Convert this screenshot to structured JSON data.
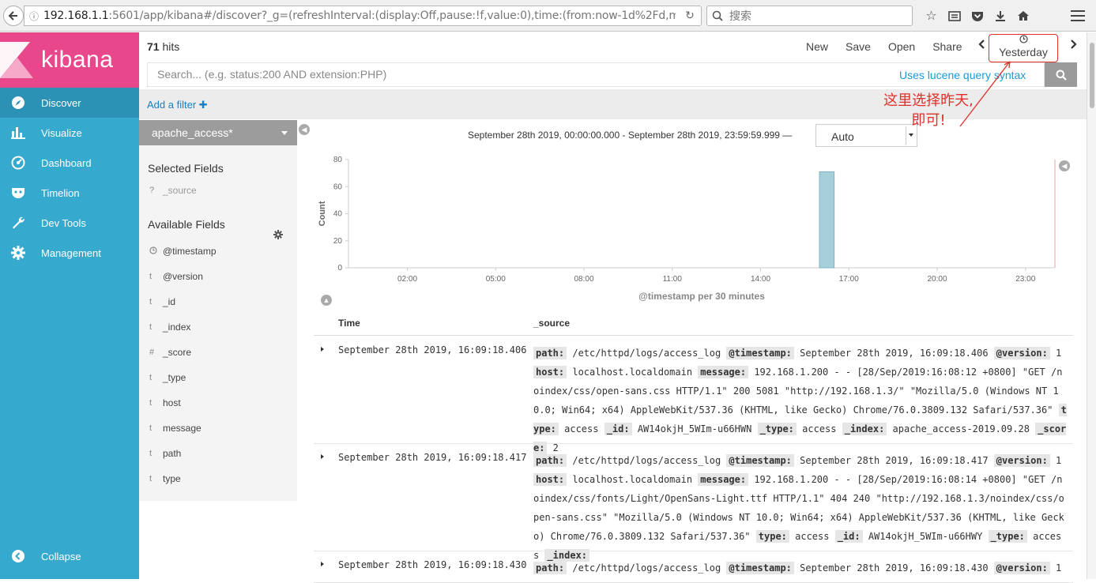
{
  "browser": {
    "url_host": "192.168.1.1",
    "url_rest": ":5601/app/kibana#/discover?_g=(refreshInterval:(display:Off,pause:!f,value:0),time:(from:now-1d%2Fd,m",
    "search_placeholder": "搜索"
  },
  "sidebar": {
    "logo_text": "kibana",
    "items": [
      {
        "label": "Discover",
        "icon": "compass-icon"
      },
      {
        "label": "Visualize",
        "icon": "bar-chart-icon"
      },
      {
        "label": "Dashboard",
        "icon": "dashboard-icon"
      },
      {
        "label": "Timelion",
        "icon": "timelion-mask-icon"
      },
      {
        "label": "Dev Tools",
        "icon": "wrench-icon"
      },
      {
        "label": "Management",
        "icon": "gear-icon"
      }
    ],
    "collapse_label": "Collapse"
  },
  "topbar": {
    "hits_count": "71",
    "hits_label": " hits",
    "actions": [
      "New",
      "Save",
      "Open",
      "Share"
    ],
    "time_picker": "Yesterday"
  },
  "query": {
    "placeholder": "Search... (e.g. status:200 AND extension:PHP)",
    "lucene_link": "Uses lucene query syntax"
  },
  "filter": {
    "add_filter": "Add a filter"
  },
  "fields": {
    "index_pattern": "apache_access*",
    "selected_title": "Selected Fields",
    "selected": [
      {
        "type": "?",
        "name": "_source"
      }
    ],
    "available_title": "Available Fields",
    "available": [
      {
        "type": "clock",
        "name": "@timestamp"
      },
      {
        "type": "t",
        "name": "@version"
      },
      {
        "type": "t",
        "name": "_id"
      },
      {
        "type": "t",
        "name": "_index"
      },
      {
        "type": "#",
        "name": "_score"
      },
      {
        "type": "t",
        "name": "_type"
      },
      {
        "type": "t",
        "name": "host"
      },
      {
        "type": "t",
        "name": "message"
      },
      {
        "type": "t",
        "name": "path"
      },
      {
        "type": "t",
        "name": "type"
      }
    ]
  },
  "histogram": {
    "range": "September 28th 2019, 00:00:00.000 - September 28th 2019, 23:59:59.999 —",
    "interval": "Auto"
  },
  "annotation": {
    "line1": "这里选择昨天,",
    "line2": "即可!"
  },
  "chart_data": {
    "type": "bar",
    "title": "",
    "xlabel": "@timestamp per 30 minutes",
    "ylabel": "Count",
    "ylim": [
      0,
      80
    ],
    "yticks": [
      0,
      20,
      40,
      60,
      80
    ],
    "xlim_hours": [
      0,
      24
    ],
    "xticks": [
      "02:00",
      "05:00",
      "08:00",
      "11:00",
      "14:00",
      "17:00",
      "20:00",
      "23:00"
    ],
    "bars": [
      {
        "x": "16:00",
        "value": 71
      }
    ],
    "bar_color": "#a6cfda"
  },
  "table": {
    "headers": {
      "time": "Time",
      "source": "_source"
    },
    "rows": [
      {
        "time": "September 28th 2019, 16:09:18.406",
        "fields": [
          [
            "path:",
            " /etc/httpd/logs/access_log "
          ],
          [
            "@timestamp:",
            " September 28th 2019, 16:09:18.406 "
          ],
          [
            "@version:",
            " 1 "
          ],
          [
            "host:",
            " localhost.localdomain "
          ],
          [
            "message:",
            " 192.168.1.200 - - [28/Sep/2019:16:08:12 +0800] \"GET /noindex/css/open-sans.css HTTP/1.1\" 200 5081 \"http://192.168.1.3/\" \"Mozilla/5.0 (Windows NT 10.0; Win64; x64) AppleWebKit/537.36 (KHTML, like Gecko) Chrome/76.0.3809.132 Safari/537.36\" "
          ],
          [
            "type:",
            " access "
          ],
          [
            "_id:",
            " AW14okjH_5WIm-u66HWN "
          ],
          [
            "_type:",
            " access "
          ],
          [
            "_index:",
            " apache_access-2019.09.28 "
          ],
          [
            "_score:",
            " 2"
          ]
        ]
      },
      {
        "time": "September 28th 2019, 16:09:18.417",
        "fields": [
          [
            "path:",
            " /etc/httpd/logs/access_log "
          ],
          [
            "@timestamp:",
            " September 28th 2019, 16:09:18.417 "
          ],
          [
            "@version:",
            " 1 "
          ],
          [
            "host:",
            " localhost.localdomain "
          ],
          [
            "message:",
            " 192.168.1.200 - - [28/Sep/2019:16:08:14 +0800] \"GET /noindex/css/fonts/Light/OpenSans-Light.ttf HTTP/1.1\" 404 240 \"http://192.168.1.3/noindex/css/open-sans.css\" \"Mozilla/5.0 (Windows NT 10.0; Win64; x64) AppleWebKit/537.36 (KHTML, like Gecko) Chrome/76.0.3809.132 Safari/537.36\" "
          ],
          [
            "type:",
            " access "
          ],
          [
            "_id:",
            " AW14okjH_5WIm-u66HWY "
          ],
          [
            "_type:",
            " access "
          ],
          [
            "_index:",
            ""
          ]
        ]
      },
      {
        "time": "September 28th 2019, 16:09:18.430",
        "fields": [
          [
            "path:",
            " /etc/httpd/logs/access_log "
          ],
          [
            "@timestamp:",
            " September 28th 2019, 16:09:18.430 "
          ],
          [
            "@version:",
            " 1"
          ]
        ]
      }
    ]
  }
}
